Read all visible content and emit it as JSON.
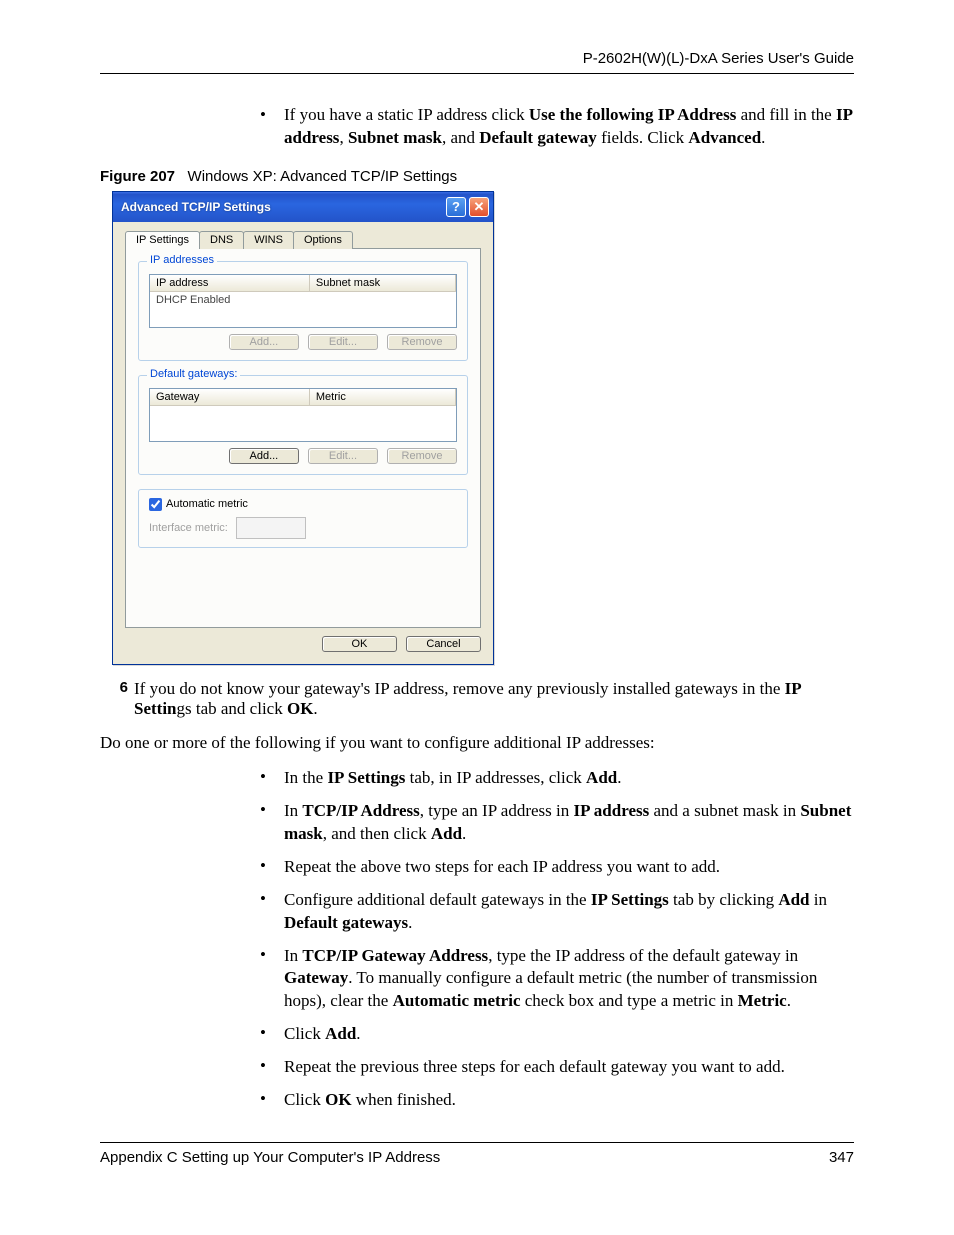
{
  "header": {
    "title": "P-2602H(W)(L)-DxA Series User's Guide"
  },
  "intro_bullet": {
    "pre": "If you have a static IP address click ",
    "b1": "Use the following IP Address",
    "mid1": " and fill in the ",
    "b2": "IP address",
    "sep1": ", ",
    "b3": "Subnet mask",
    "sep2": ", and ",
    "b4": "Default gateway",
    "mid2": " fields. Click ",
    "b5": "Advanced",
    "end": "."
  },
  "figure": {
    "label": "Figure 207",
    "caption": "Windows XP: Advanced TCP/IP Settings"
  },
  "dialog": {
    "title": "Advanced TCP/IP Settings",
    "tabs": {
      "ip": "IP Settings",
      "dns": "DNS",
      "wins": "WINS",
      "options": "Options"
    },
    "group1": {
      "legend": "IP addresses",
      "col1": "IP address",
      "col2": "Subnet mask",
      "row1": "DHCP Enabled",
      "add": "Add...",
      "edit": "Edit...",
      "remove": "Remove"
    },
    "group2": {
      "legend": "Default gateways:",
      "col1": "Gateway",
      "col2": "Metric",
      "add": "Add...",
      "edit": "Edit...",
      "remove": "Remove"
    },
    "auto_label": "Automatic metric",
    "iface_label": "Interface metric:",
    "ok": "OK",
    "cancel": "Cancel"
  },
  "step6": {
    "num": "6",
    "pre": "If you do not know your gateway's IP address, remove any previously installed gateways in the ",
    "b1": "IP Settin",
    "mid": "gs tab and click ",
    "b2": "OK",
    "end": "."
  },
  "para": "Do one or more of the following if you want to configure additional IP addresses:",
  "bullets": {
    "a": {
      "p1": "In the ",
      "b1": "IP Settings",
      "p2": " tab, in IP addresses, click ",
      "b2": "Add",
      "p3": "."
    },
    "b": {
      "p1": "In ",
      "b1": "TCP/IP Address",
      "p2": ", type an IP address in ",
      "b2": "IP address",
      "p3": " and a subnet mask in ",
      "b3": "Subnet mask",
      "p4": ", and then click ",
      "b4": "Add",
      "p5": "."
    },
    "c": {
      "p1": "Repeat the above two steps for each IP address you want to add."
    },
    "d": {
      "p1": "Configure additional default gateways in the ",
      "b1": "IP Settings",
      "p2": " tab by clicking ",
      "b2": "Add",
      "p3": " in ",
      "b3": "Default gateways",
      "p4": "."
    },
    "e": {
      "p1": "In ",
      "b1": "TCP/IP Gateway Address",
      "p2": ", type the IP address of the default gateway in ",
      "b2": "Gateway",
      "p3": ". To manually configure a default metric (the number of transmission hops), clear the ",
      "b3": "Automatic metric",
      "p4": " check box and type a metric in ",
      "b4": "Metric",
      "p5": "."
    },
    "f": {
      "p1": "Click ",
      "b1": "Add",
      "p2": "."
    },
    "g": {
      "p1": "Repeat the previous three steps for each default gateway you want to add."
    },
    "h": {
      "p1": "Click ",
      "b1": "OK",
      "p2": " when finished."
    }
  },
  "footer": {
    "left": "Appendix C Setting up Your Computer's IP Address",
    "right": "347"
  }
}
